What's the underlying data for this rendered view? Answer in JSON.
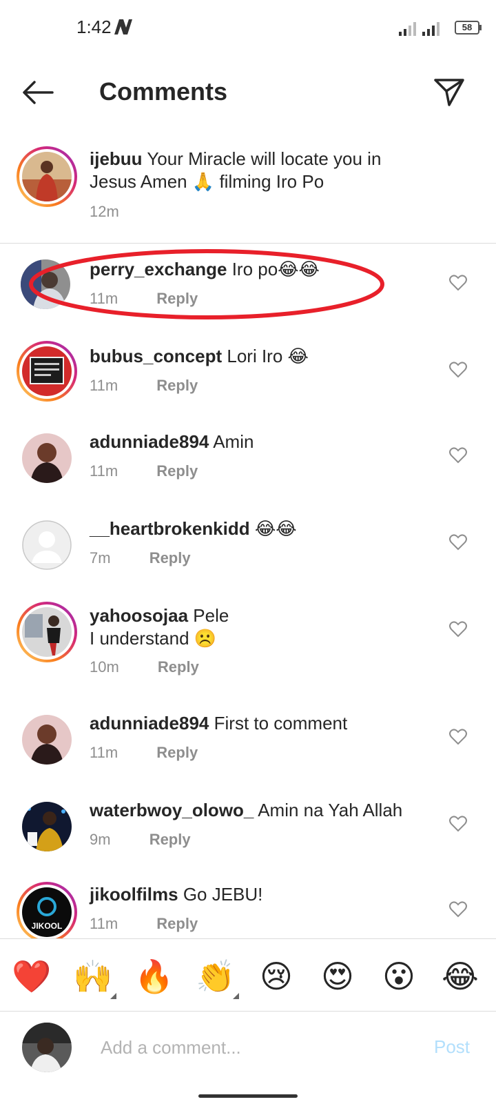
{
  "status_bar": {
    "time": "1:42",
    "battery": "58"
  },
  "header": {
    "title": "Comments"
  },
  "caption": {
    "username": "ijebuu",
    "text": "Your Miracle will locate you in Jesus Amen 🙏 filming Iro Po",
    "time": "12m"
  },
  "comments": [
    {
      "username": "perry_exchange",
      "text": "Iro po😂😂",
      "time": "11m",
      "reply": "Reply"
    },
    {
      "username": "bubus_concept",
      "text": "Lori Iro 😂",
      "time": "11m",
      "reply": "Reply"
    },
    {
      "username": "adunniade894",
      "text": "Amin",
      "time": "11m",
      "reply": "Reply"
    },
    {
      "username": "__heartbrokenkidd",
      "text": "😂😂",
      "time": "7m",
      "reply": "Reply"
    },
    {
      "username": "yahoosojaa",
      "text": "Pele\nI understand ☹️",
      "time": "10m",
      "reply": "Reply"
    },
    {
      "username": "adunniade894",
      "text": "First to comment",
      "time": "11m",
      "reply": "Reply"
    },
    {
      "username": "waterbwoy_olowo_",
      "text": "Amin na Yah Allah",
      "time": "9m",
      "reply": "Reply"
    },
    {
      "username": "jikoolfilms",
      "text": "Go JEBU!",
      "time": "11m",
      "reply": "Reply",
      "avatar_text": "JIKOOL"
    }
  ],
  "emoji_bar": [
    "❤️",
    "🙌",
    "🔥",
    "👏",
    "😢",
    "😍",
    "😮",
    "😂"
  ],
  "input": {
    "placeholder": "Add a comment...",
    "post_label": "Post"
  },
  "colors": {
    "annotation": "#e8202a",
    "link": "#b2dffc",
    "meta": "#8e8e8e"
  }
}
